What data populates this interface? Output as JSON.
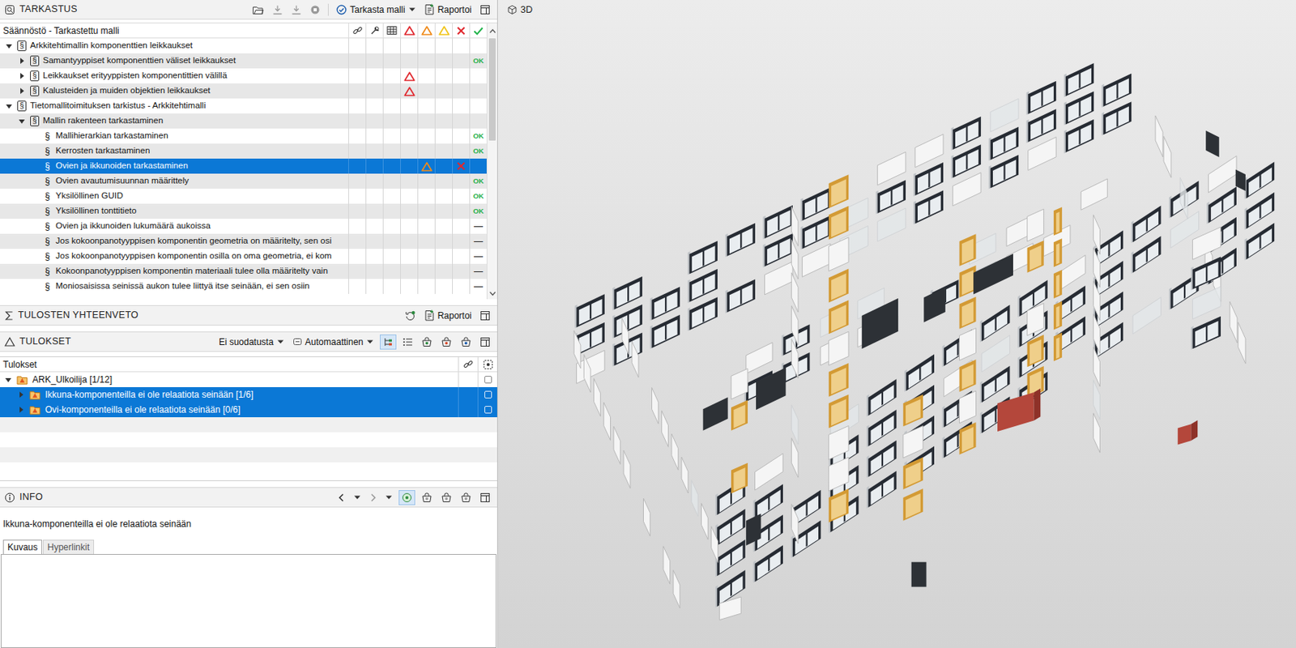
{
  "inspection": {
    "title": "TARKASTUS",
    "check_button": "Tarkasta malli",
    "report_button": "Raportoi",
    "table": {
      "header": "Säännöstö - Tarkastettu malli",
      "rows": [
        {
          "label": "Arkkitehtimallin komponenttien leikkaukset",
          "symbol": "§",
          "level": 0,
          "kind": "ruleset",
          "expanded": true,
          "selected": false,
          "critical": false,
          "moderate": false,
          "low": false,
          "rejected": false,
          "result": ""
        },
        {
          "label": "Samantyyppiset komponenttien väliset leikkaukset",
          "symbol": "§",
          "level": 1,
          "kind": "ruleset",
          "expanded": false,
          "selected": false,
          "critical": false,
          "moderate": false,
          "low": false,
          "rejected": false,
          "result": "OK"
        },
        {
          "label": "Leikkaukset erityyppisten komponentittien välillä",
          "symbol": "§",
          "level": 1,
          "kind": "ruleset",
          "expanded": false,
          "selected": false,
          "critical": true,
          "moderate": false,
          "low": false,
          "rejected": false,
          "result": ""
        },
        {
          "label": "Kalusteiden ja muiden objektien leikkaukset",
          "symbol": "§",
          "level": 1,
          "kind": "ruleset",
          "expanded": false,
          "selected": false,
          "critical": true,
          "moderate": false,
          "low": false,
          "rejected": false,
          "result": ""
        },
        {
          "label": "Tietomallitoimituksen tarkistus - Arkkitehtimalli",
          "symbol": "§",
          "level": 0,
          "kind": "ruleset",
          "expanded": true,
          "selected": false,
          "critical": false,
          "moderate": false,
          "low": false,
          "rejected": false,
          "result": ""
        },
        {
          "label": "Mallin rakenteen tarkastaminen",
          "symbol": "§",
          "level": 1,
          "kind": "ruleset",
          "expanded": true,
          "selected": false,
          "critical": false,
          "moderate": false,
          "low": false,
          "rejected": false,
          "result": ""
        },
        {
          "label": "Mallihierarkian tarkastaminen",
          "symbol": "§",
          "level": 2,
          "kind": "rule",
          "selected": false,
          "critical": false,
          "moderate": false,
          "low": false,
          "rejected": false,
          "result": "OK"
        },
        {
          "label": "Kerrosten tarkastaminen",
          "symbol": "§",
          "level": 2,
          "kind": "rule",
          "selected": false,
          "critical": false,
          "moderate": false,
          "low": false,
          "rejected": false,
          "result": "OK"
        },
        {
          "label": "Ovien ja ikkunoiden tarkastaminen",
          "symbol": "§",
          "level": 2,
          "kind": "rule",
          "selected": true,
          "critical": false,
          "moderate": true,
          "low": false,
          "rejected": true,
          "result": ""
        },
        {
          "label": "Ovien avautumisuunnan määrittely",
          "symbol": "§",
          "level": 2,
          "kind": "rule",
          "selected": false,
          "critical": false,
          "moderate": false,
          "low": false,
          "rejected": false,
          "result": "OK"
        },
        {
          "label": "Yksilöllinen GUID",
          "symbol": "§",
          "level": 2,
          "kind": "rule",
          "selected": false,
          "critical": false,
          "moderate": false,
          "low": false,
          "rejected": false,
          "result": "OK"
        },
        {
          "label": "Yksilöllinen tonttitieto",
          "symbol": "§",
          "level": 2,
          "kind": "rule",
          "selected": false,
          "critical": false,
          "moderate": false,
          "low": false,
          "rejected": false,
          "result": "OK"
        },
        {
          "label": "Ovien ja ikkunoiden lukumäärä aukoissa",
          "symbol": "§",
          "level": 2,
          "kind": "rule",
          "selected": false,
          "critical": false,
          "moderate": false,
          "low": false,
          "rejected": false,
          "result": "—"
        },
        {
          "label": "Jos kokoonpanotyyppisen komponentin geometria on määritelty, sen osi",
          "symbol": "§",
          "level": 2,
          "kind": "rule",
          "selected": false,
          "critical": false,
          "moderate": false,
          "low": false,
          "rejected": false,
          "result": "—"
        },
        {
          "label": "Jos kokoonpanotyyppisen komponentin osilla on oma geometria, ei kom",
          "symbol": "§",
          "level": 2,
          "kind": "rule",
          "selected": false,
          "critical": false,
          "moderate": false,
          "low": false,
          "rejected": false,
          "result": "—"
        },
        {
          "label": "Kokoonpanotyyppisen komponentin materiaali tulee olla määritelty vain",
          "symbol": "§",
          "level": 2,
          "kind": "rule",
          "selected": false,
          "critical": false,
          "moderate": false,
          "low": false,
          "rejected": false,
          "result": "—"
        },
        {
          "label": "Moniosaisissa seinissä aukon tulee liittyä itse seinään, ei sen osiin",
          "symbol": "§",
          "level": 2,
          "kind": "rule",
          "selected": false,
          "critical": false,
          "moderate": false,
          "low": false,
          "rejected": false,
          "result": "—"
        }
      ]
    }
  },
  "summary": {
    "title": "TULOSTEN YHTEENVETO",
    "report_button": "Raportoi"
  },
  "results": {
    "title": "TULOKSET",
    "filter": "Ei suodatusta",
    "mode": "Automaattinen",
    "header": "Tulokset",
    "rows": [
      {
        "label": "ARK_Ulkoilija [1/12]",
        "level": 0,
        "expanded": true,
        "selected": false
      },
      {
        "label": "Ikkuna-komponenteilla ei ole relaatiota seinään [1/6]",
        "level": 1,
        "expanded": false,
        "selected": true
      },
      {
        "label": "Ovi-komponenteilla ei ole relaatiota seinään [0/6]",
        "level": 1,
        "expanded": false,
        "selected": true
      }
    ]
  },
  "info": {
    "title": "INFO",
    "heading": "Ikkuna-komponenteilla ei ole relaatiota seinään",
    "tabs": [
      {
        "label": "Kuvaus",
        "selected": true
      },
      {
        "label": "Hyperlinkit",
        "selected": false
      }
    ],
    "description": ""
  },
  "view": {
    "title": "3D"
  }
}
